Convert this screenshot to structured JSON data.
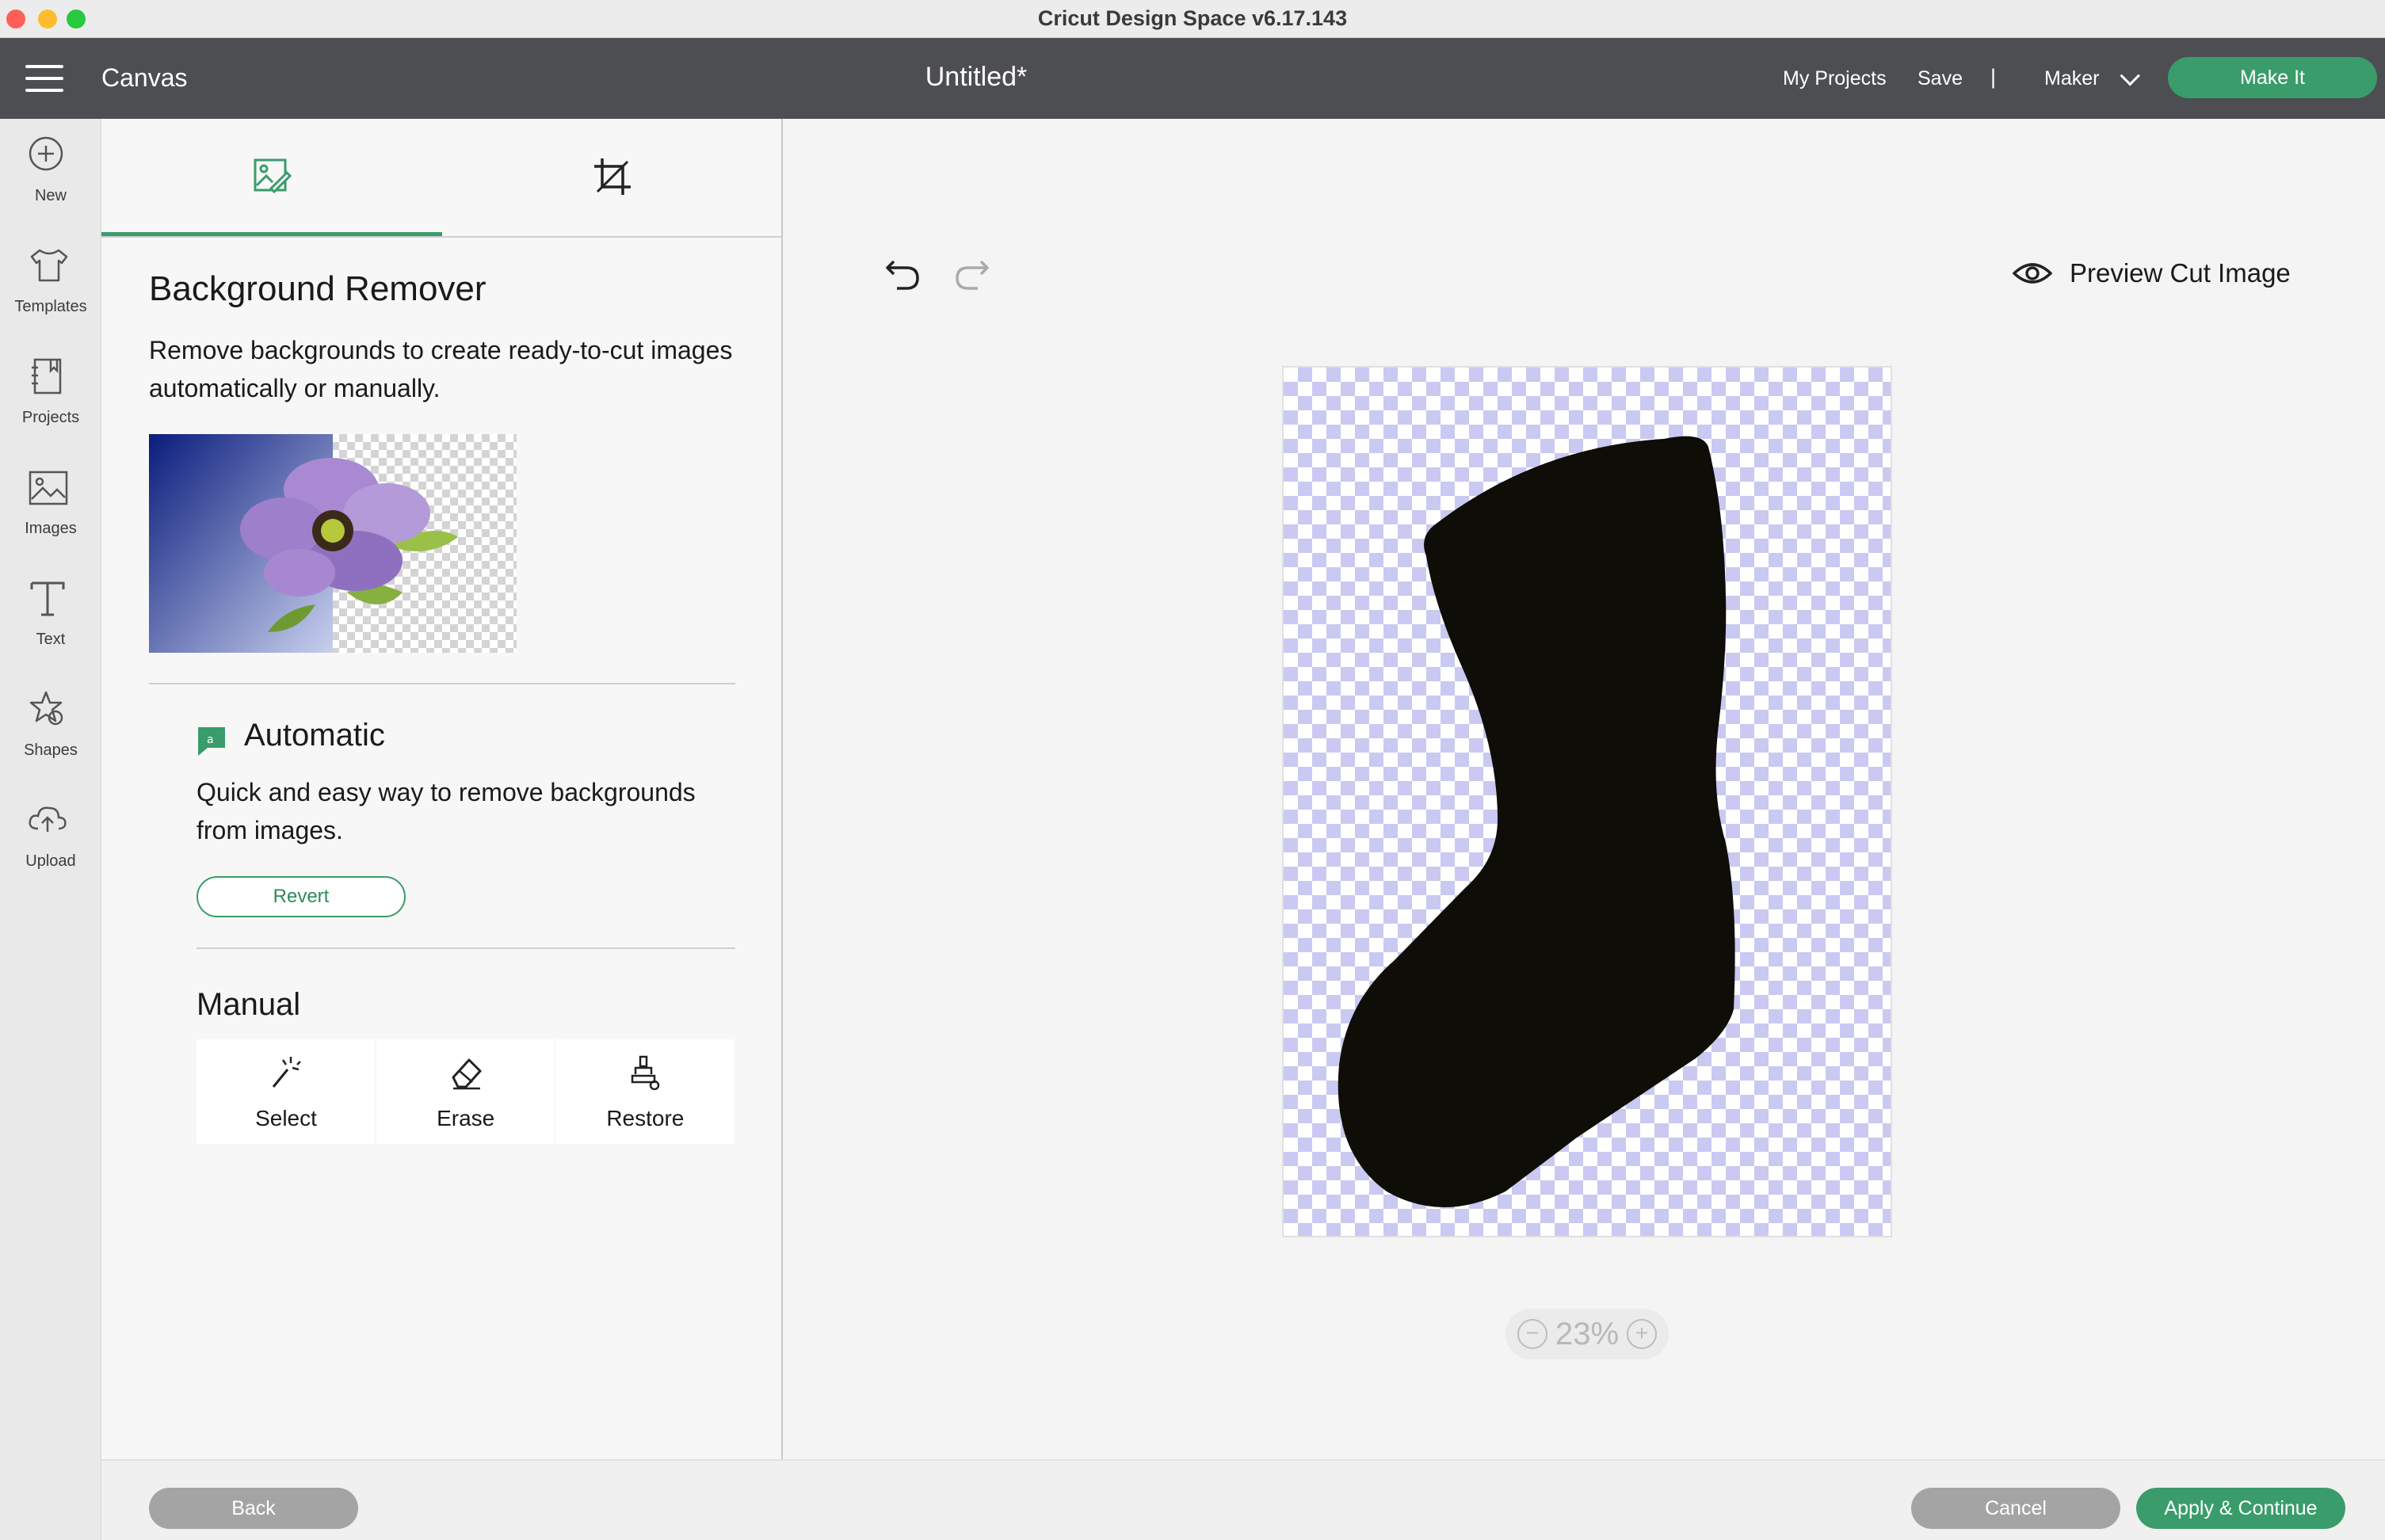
{
  "window": {
    "title": "Cricut Design Space  v6.17.143"
  },
  "header": {
    "section": "Canvas",
    "document_title": "Untitled*",
    "my_projects": "My Projects",
    "save": "Save",
    "separator": "|",
    "machine": "Maker",
    "make_it": "Make It"
  },
  "sidebar": {
    "items": [
      {
        "label": "New",
        "icon": "plus-circle-icon"
      },
      {
        "label": "Templates",
        "icon": "tshirt-icon"
      },
      {
        "label": "Projects",
        "icon": "notebook-icon"
      },
      {
        "label": "Images",
        "icon": "image-icon"
      },
      {
        "label": "Text",
        "icon": "text-icon"
      },
      {
        "label": "Shapes",
        "icon": "shapes-icon"
      },
      {
        "label": "Upload",
        "icon": "cloud-upload-icon"
      }
    ]
  },
  "panel": {
    "tabs": [
      {
        "icon": "background-remover-icon",
        "active": true
      },
      {
        "icon": "crop-icon",
        "active": false
      }
    ],
    "title": "Background Remover",
    "description": "Remove backgrounds to create ready-to-cut images automatically or manually.",
    "automatic": {
      "title": "Automatic",
      "description": "Quick and easy way to remove backgrounds from images.",
      "revert": "Revert"
    },
    "manual": {
      "title": "Manual",
      "tools": [
        {
          "label": "Select",
          "icon": "magic-wand-icon"
        },
        {
          "label": "Erase",
          "icon": "eraser-icon"
        },
        {
          "label": "Restore",
          "icon": "restore-brush-icon"
        }
      ]
    }
  },
  "canvas": {
    "preview_label": "Preview Cut Image",
    "zoom": "23%",
    "checker_color": "#c9c9f2",
    "shape_color": "#0e0d08"
  },
  "footer": {
    "back": "Back",
    "cancel": "Cancel",
    "apply": "Apply & Continue"
  },
  "colors": {
    "accent": "#3a9c6b",
    "header_bg": "#4d4e52",
    "disabled_button": "#a4a4a4"
  }
}
